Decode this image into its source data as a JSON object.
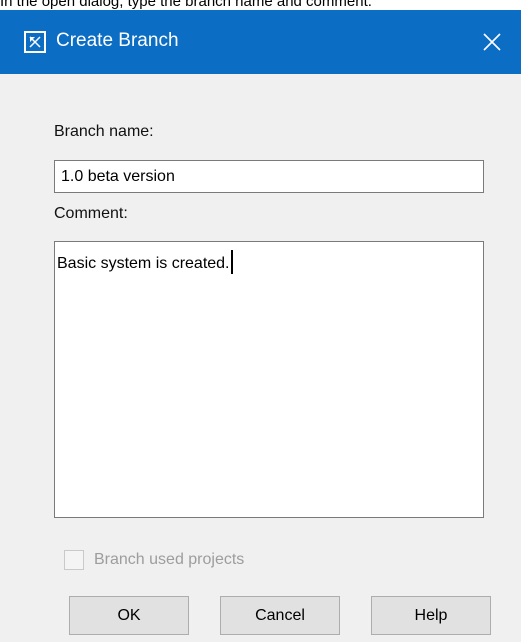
{
  "caption": "In the open dialog, type the branch name and comment.",
  "dialog": {
    "title": "Create Branch",
    "branch_name_label": "Branch name:",
    "branch_name_value": "1.0 beta version",
    "comment_label": "Comment:",
    "comment_value": "Basic system is created.",
    "branch_used_projects_label": "Branch used projects",
    "branch_used_projects_checked": false,
    "branch_used_projects_enabled": false,
    "buttons": {
      "ok": "OK",
      "cancel": "Cancel",
      "help": "Help"
    }
  },
  "colors": {
    "titlebar": "#0b6dc4",
    "dialog_bg": "#f0f0f0",
    "disabled_text": "#9d9d9d"
  },
  "icons": {
    "title": "diagram-window-icon",
    "close": "close-icon"
  }
}
